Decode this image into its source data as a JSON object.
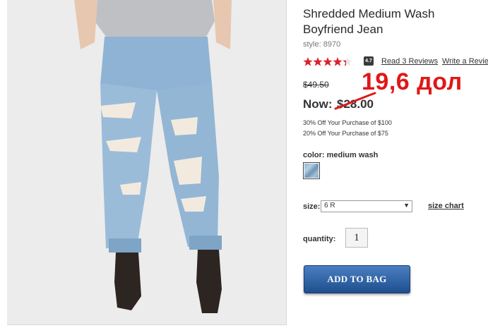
{
  "product": {
    "title": "Shredded Medium Wash Boyfriend Jean",
    "style": "style: 8970",
    "rating": 4.7,
    "rating_badge": "4.7",
    "read_reviews": "Read 3 Reviews",
    "write_review": "Write a Review",
    "was_price": "$49.50",
    "now_label": "Now:",
    "now_price": "$28.00",
    "promos": [
      "30% Off Your Purchase of $100",
      "20% Off Your Purchase of $75"
    ],
    "color_label": "color:",
    "color_value": "medium wash",
    "size_label": "size:",
    "size_value": "6 R",
    "size_chart": "size chart",
    "quantity_label": "quantity:",
    "quantity_value": "1",
    "add_to_bag": "ADD TO BAG"
  },
  "annotation": {
    "text": "19,6 дол",
    "color": "#e01818"
  },
  "colors": {
    "star": "#d9232d",
    "button": "#2a5da3"
  }
}
